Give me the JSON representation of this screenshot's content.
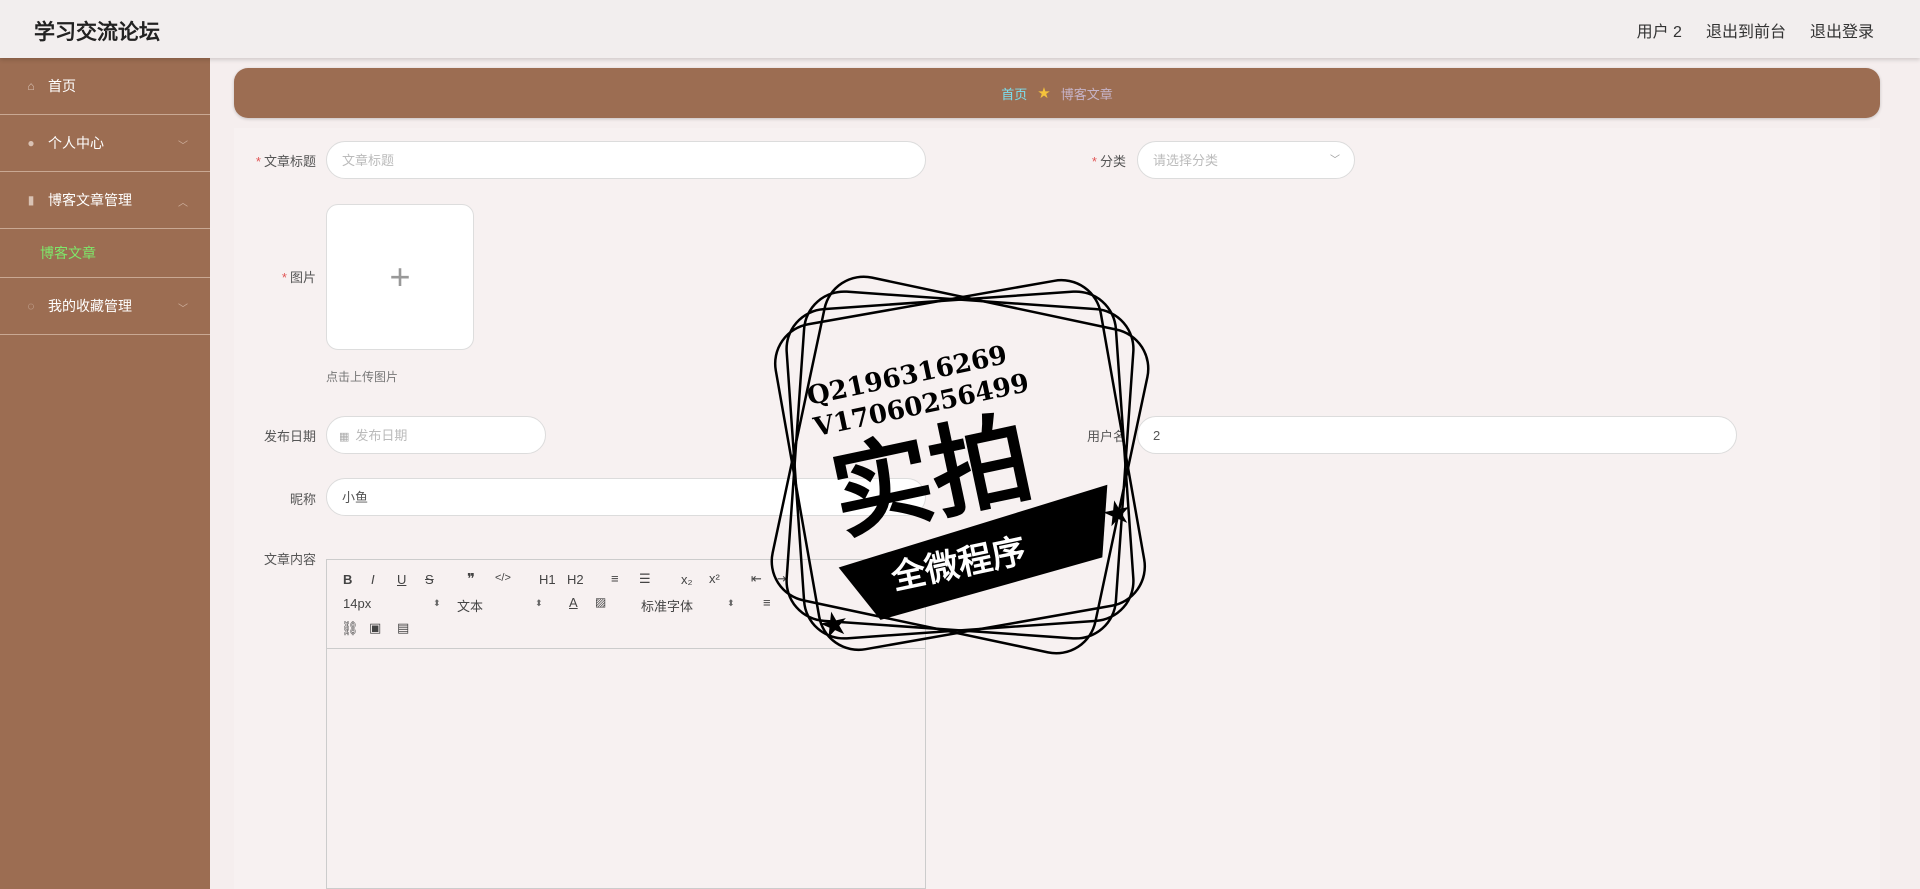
{
  "app": {
    "title": "学习交流论坛"
  },
  "header": {
    "user": "用户 2",
    "to_front": "退出到前台",
    "logout": "退出登录"
  },
  "sidebar": {
    "items": [
      {
        "label": "首页",
        "icon": "home-icon"
      },
      {
        "label": "个人中心",
        "icon": "user-icon"
      },
      {
        "label": "博客文章管理",
        "icon": "chart-icon"
      },
      {
        "label": "我的收藏管理",
        "icon": "power-icon"
      }
    ],
    "subitem": "博客文章"
  },
  "breadcrumb": {
    "home": "首页",
    "current": "博客文章"
  },
  "form": {
    "title_label": "文章标题",
    "title_placeholder": "文章标题",
    "category_label": "分类",
    "category_placeholder": "请选择分类",
    "image_label": "图片",
    "upload_tip": "点击上传图片",
    "date_label": "发布日期",
    "date_placeholder": "发布日期",
    "username_label": "用户名",
    "username_value": "2",
    "nickname_label": "昵称",
    "nickname_value": "小鱼",
    "content_label": "文章内容"
  },
  "editor": {
    "font_size": "14px",
    "format": "文本",
    "font_family": "标准字体",
    "buttons": [
      "B",
      "I",
      "U",
      "S",
      "❞",
      "</>",
      "H1",
      "H2",
      "≡",
      "☰",
      "x₂",
      "x²",
      "⇤",
      "⇥"
    ]
  },
  "stamp": {
    "line1": "Q2196316269",
    "line2": "V17060256499",
    "main": "实拍",
    "banner": "全微程序"
  }
}
